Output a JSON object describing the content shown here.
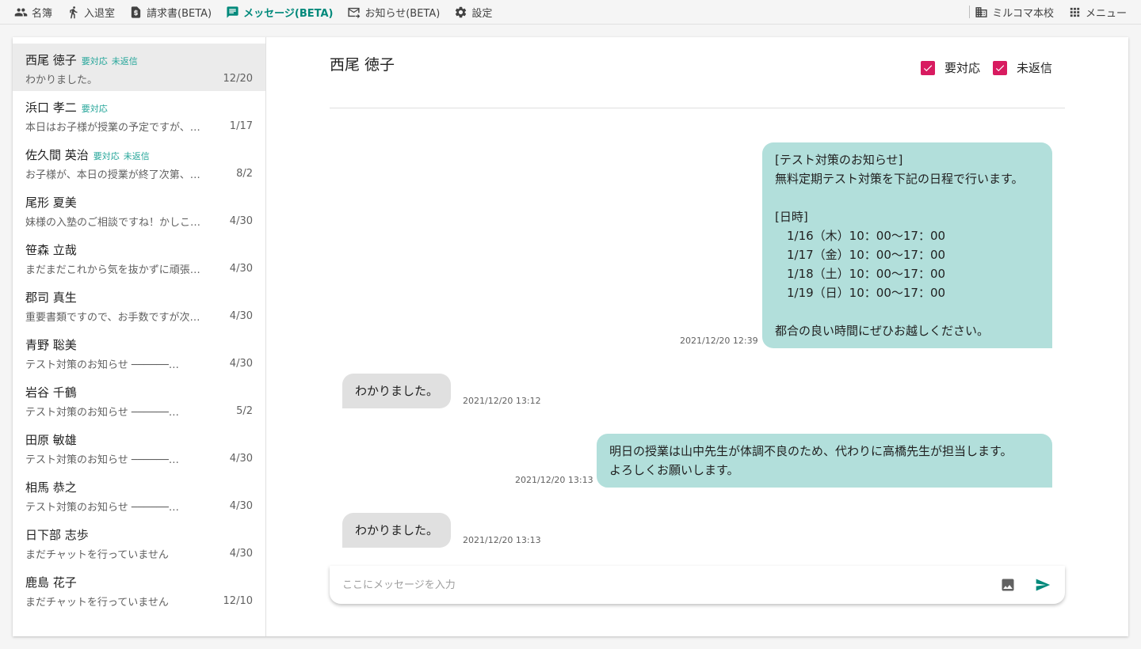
{
  "nav": {
    "left": [
      {
        "label": "名簿",
        "icon": "people-icon",
        "active": false
      },
      {
        "label": "入退室",
        "icon": "walk-icon",
        "active": false
      },
      {
        "label": "請求書(BETA)",
        "icon": "invoice-icon",
        "active": false
      },
      {
        "label": "メッセージ(BETA)",
        "icon": "message-icon",
        "active": true
      },
      {
        "label": "お知らせ(BETA)",
        "icon": "mail-icon",
        "active": false
      },
      {
        "label": "設定",
        "icon": "gear-icon",
        "active": false
      }
    ],
    "school": "ミルコマ本校",
    "menu": "メニュー"
  },
  "contacts": [
    {
      "name": "西尾 徳子",
      "tags": [
        "要対応",
        "未返信"
      ],
      "preview": "わかりました。",
      "date": "12/20",
      "selected": true
    },
    {
      "name": "浜口 孝二",
      "tags": [
        "要対応"
      ],
      "preview": "本日はお子様が授業の予定ですが、…",
      "date": "1/17",
      "selected": false
    },
    {
      "name": "佐久間 英治",
      "tags": [
        "要対応",
        "未返信"
      ],
      "preview": "お子様が、本日の授業が終了次第、…",
      "date": "8/2",
      "selected": false
    },
    {
      "name": "尾形 夏美",
      "tags": [],
      "preview": "妹様の入塾のご相談ですね！かしこ…",
      "date": "4/30",
      "selected": false
    },
    {
      "name": "笹森 立哉",
      "tags": [],
      "preview": "まだまだこれから気を抜かずに頑張…",
      "date": "4/30",
      "selected": false
    },
    {
      "name": "郡司 真生",
      "tags": [],
      "preview": "重要書類ですので、お手数ですが次…",
      "date": "4/30",
      "selected": false
    },
    {
      "name": "青野 聡美",
      "tags": [],
      "preview": "テスト対策のお知らせ ──────…",
      "date": "4/30",
      "selected": false
    },
    {
      "name": "岩谷 千鶴",
      "tags": [],
      "preview": "テスト対策のお知らせ ──────…",
      "date": "5/2",
      "selected": false
    },
    {
      "name": "田原 敏雄",
      "tags": [],
      "preview": "テスト対策のお知らせ ──────…",
      "date": "4/30",
      "selected": false
    },
    {
      "name": "相馬 恭之",
      "tags": [],
      "preview": "テスト対策のお知らせ ──────…",
      "date": "4/30",
      "selected": false
    },
    {
      "name": "日下部 志歩",
      "tags": [],
      "preview": "まだチャットを行っていません",
      "date": "4/30",
      "selected": false
    },
    {
      "name": "鹿島 花子",
      "tags": [],
      "preview": "まだチャットを行っていません",
      "date": "12/10",
      "selected": false
    }
  ],
  "chat": {
    "title": "西尾 徳子",
    "flag1": "要対応",
    "flag2": "未返信",
    "messages": [
      {
        "direction": "out",
        "text": "[テスト対策のお知らせ]\n無料定期テスト対策を下記の日程で行います。\n\n[日時]\n　1/16（木）10：00〜17：00\n　1/17（金）10：00〜17：00\n　1/18（土）10：00〜17：00\n　1/19（日）10：00〜17：00\n\n都合の良い時間にぜひお越しください。",
        "time": "2021/12/20 12:39"
      },
      {
        "direction": "in",
        "text": "わかりました。",
        "time": "2021/12/20 13:12"
      },
      {
        "direction": "out",
        "text": "明日の授業は山中先生が体調不良のため、代わりに高橋先生が担当します。\nよろしくお願いします。",
        "time": "2021/12/20 13:13"
      },
      {
        "direction": "in",
        "text": "わかりました。",
        "time": "2021/12/20 13:13"
      }
    ],
    "input_placeholder": "ここにメッセージを入力",
    "input_value": ""
  },
  "colors": {
    "accent": "#00897b",
    "tag": "#26a69a",
    "checkbox": "#d81b60",
    "bubble_out": "#b2dfdb",
    "bubble_in": "#e0e0e0"
  }
}
